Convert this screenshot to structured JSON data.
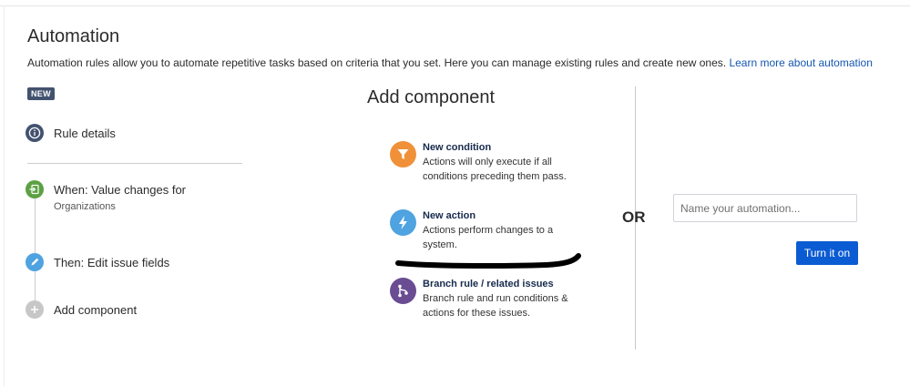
{
  "header": {
    "title": "Automation",
    "description": "Automation rules allow you to automate repetitive tasks based on criteria that you set. Here you can manage existing rules and create new ones.",
    "link_label": "Learn more about automation"
  },
  "sidebar": {
    "badge": "NEW",
    "steps": [
      {
        "label": "Rule details",
        "icon": "info-icon",
        "color": "#42526e"
      },
      {
        "label": "When: Value changes for",
        "sub": "Organizations",
        "icon": "trigger-icon",
        "color": "#5ca143"
      },
      {
        "label": "Then: Edit issue fields",
        "icon": "pencil-icon",
        "color": "#4ea3e0"
      },
      {
        "label": "Add component",
        "icon": "plus-icon",
        "color": "#c7c7c7"
      }
    ]
  },
  "add_component": {
    "title": "Add component",
    "items": [
      {
        "title": "New condition",
        "desc": "Actions will only execute if all conditions preceding them pass.",
        "icon": "filter-icon",
        "color": "#f0913a"
      },
      {
        "title": "New action",
        "desc": "Actions perform changes to a system.",
        "icon": "lightning-icon",
        "color": "#4ea3e0"
      },
      {
        "title": "Branch rule / related issues",
        "desc": "Branch rule and run conditions & actions for these issues.",
        "icon": "branch-icon",
        "color": "#6a4c93"
      }
    ]
  },
  "separator_label": "OR",
  "name_input": {
    "placeholder": "Name your automation...",
    "value": ""
  },
  "submit_button": {
    "label": "Turn it on",
    "color": "#0b5bd3"
  }
}
